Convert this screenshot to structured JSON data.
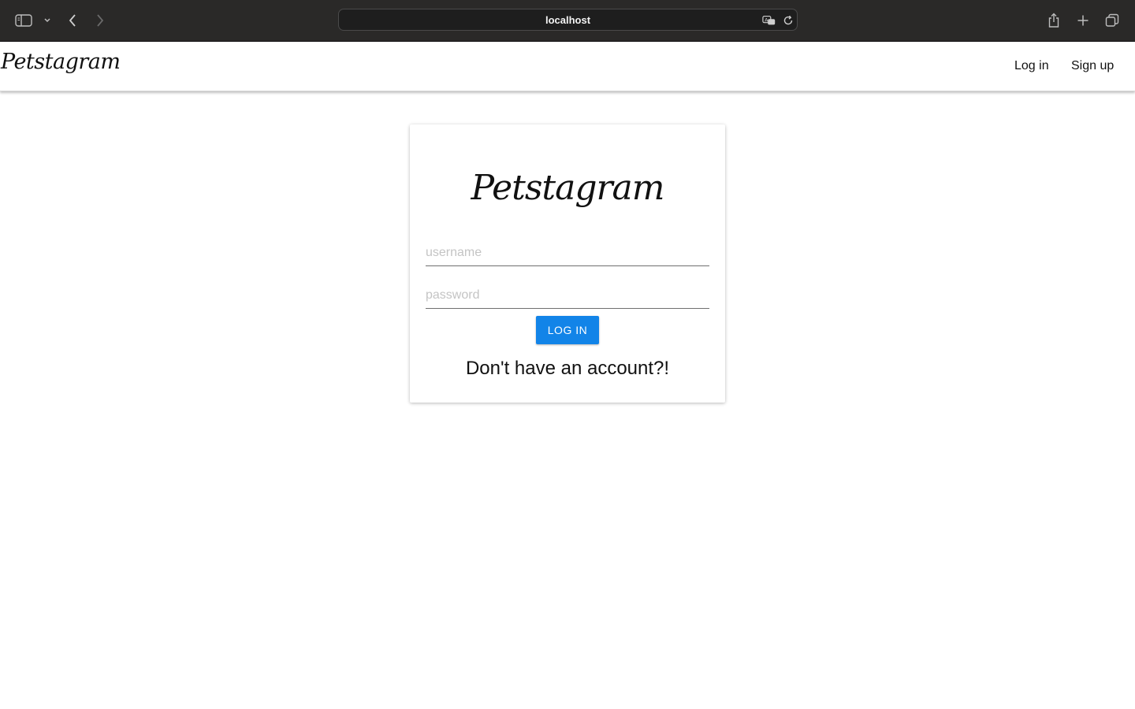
{
  "browser": {
    "url": "localhost",
    "icons": {
      "sidebar": "sidebar-icon",
      "tab_group_menu": "chevron-down-icon",
      "back": "chevron-left-icon",
      "forward": "chevron-right-icon",
      "translate": "translate-icon",
      "reload": "reload-icon",
      "share": "share-icon",
      "new_tab": "plus-icon",
      "tab_overview": "tabs-overview-icon"
    }
  },
  "header": {
    "brand": "Petstagram",
    "nav": {
      "login": "Log in",
      "signup": "Sign up"
    }
  },
  "login_card": {
    "brand": "Petstagram",
    "username_placeholder": "username",
    "password_placeholder": "password",
    "button_label": "LOG IN",
    "signup_prompt": "Don't have an account?!"
  },
  "colors": {
    "primary": "#1284e8",
    "chrome_background": "#2a2928"
  }
}
